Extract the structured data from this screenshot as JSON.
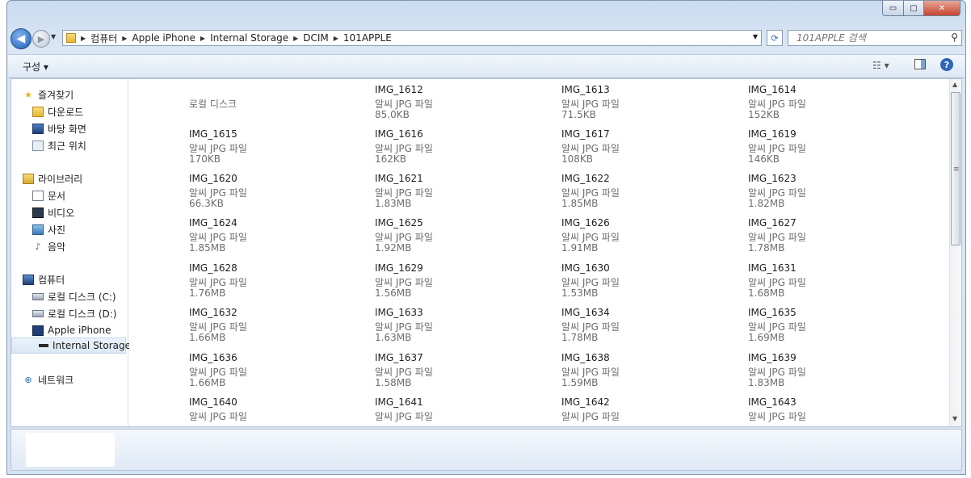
{
  "window": {
    "caption": {
      "minimize": "▭",
      "maximize": "▢",
      "close": "✕"
    }
  },
  "nav": {
    "back_glyph": "◀",
    "forward_glyph": "▶",
    "breadcrumbs": [
      "컴퓨터",
      "Apple iPhone",
      "Internal Storage",
      "DCIM",
      "101APPLE"
    ],
    "refresh_glyph": "⟳",
    "search_placeholder": "101APPLE 검색",
    "search_icon": "search-icon"
  },
  "toolbar": {
    "organize_label": "구성 ▾",
    "views_label": "☷ ▾",
    "help_label": "?"
  },
  "sidebar": {
    "favorites": {
      "label": "즐겨찾기",
      "items": [
        "다운로드",
        "바탕 화면",
        "최근 위치"
      ]
    },
    "libraries": {
      "label": "라이브러리",
      "items": [
        "문서",
        "비디오",
        "사진",
        "음악"
      ]
    },
    "computer": {
      "label": "컴퓨터",
      "items": [
        "로컬 디스크 (C:)",
        "로컬 디스크 (D:)",
        "Apple iPhone"
      ],
      "selected_child": "Internal Storage"
    },
    "network": {
      "label": "네트워크"
    }
  },
  "files": {
    "type_label": "알씨 JPG 파일",
    "drive_label": "로컬 디스크",
    "items": [
      {
        "name": "IMG_1612",
        "size": "85.0KB"
      },
      {
        "name": "IMG_1613",
        "size": "71.5KB"
      },
      {
        "name": "IMG_1614",
        "size": "152KB"
      },
      {
        "name": "IMG_1615",
        "size": "170KB"
      },
      {
        "name": "IMG_1616",
        "size": "162KB"
      },
      {
        "name": "IMG_1617",
        "size": "108KB"
      },
      {
        "name": "IMG_1619",
        "size": "146KB"
      },
      {
        "name": "IMG_1620",
        "size": "66.3KB"
      },
      {
        "name": "IMG_1621",
        "size": "1.83MB"
      },
      {
        "name": "IMG_1622",
        "size": "1.85MB"
      },
      {
        "name": "IMG_1623",
        "size": "1.82MB"
      },
      {
        "name": "IMG_1624",
        "size": "1.85MB"
      },
      {
        "name": "IMG_1625",
        "size": "1.92MB"
      },
      {
        "name": "IMG_1626",
        "size": "1.91MB"
      },
      {
        "name": "IMG_1627",
        "size": "1.78MB"
      },
      {
        "name": "IMG_1628",
        "size": "1.76MB"
      },
      {
        "name": "IMG_1629",
        "size": "1.56MB"
      },
      {
        "name": "IMG_1630",
        "size": "1.53MB"
      },
      {
        "name": "IMG_1631",
        "size": "1.68MB"
      },
      {
        "name": "IMG_1632",
        "size": "1.66MB"
      },
      {
        "name": "IMG_1633",
        "size": "1.63MB"
      },
      {
        "name": "IMG_1634",
        "size": "1.78MB"
      },
      {
        "name": "IMG_1635",
        "size": "1.69MB"
      },
      {
        "name": "IMG_1636",
        "size": "1.66MB"
      },
      {
        "name": "IMG_1637",
        "size": "1.58MB"
      },
      {
        "name": "IMG_1638",
        "size": "1.59MB"
      },
      {
        "name": "IMG_1639",
        "size": "1.83MB"
      },
      {
        "name": "IMG_1640",
        "size": ""
      },
      {
        "name": "IMG_1641",
        "size": ""
      },
      {
        "name": "IMG_1642",
        "size": ""
      },
      {
        "name": "IMG_1643",
        "size": ""
      }
    ]
  },
  "scrollbar": {
    "up": "▲",
    "down": "▼",
    "grip": "≡"
  }
}
